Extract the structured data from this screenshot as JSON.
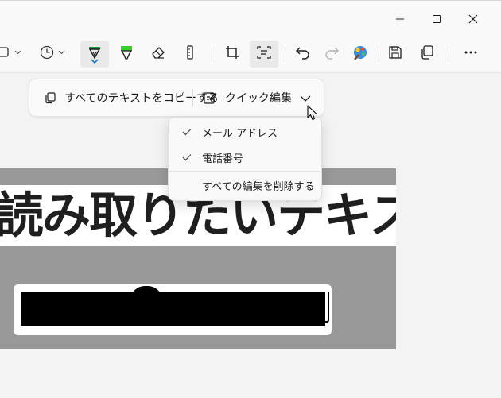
{
  "titlebar": {
    "minimize_icon": "minimize-icon",
    "maximize_icon": "maximize-icon",
    "close_icon": "close-icon"
  },
  "toolbar": {
    "items": [
      {
        "name": "shape-selection-tool",
        "icon": "rectangle-select-icon",
        "has_dropdown": true
      },
      {
        "name": "delay-timer",
        "icon": "clock-icon",
        "has_dropdown": true
      },
      {
        "name": "ballpoint-pen",
        "icon": "pen-icon",
        "active": true,
        "color": "#1a9c4a"
      },
      {
        "name": "highlighter",
        "icon": "highlighter-icon",
        "color": "#2fd12f"
      },
      {
        "name": "eraser",
        "icon": "eraser-icon"
      },
      {
        "name": "ruler",
        "icon": "ruler-icon"
      },
      {
        "name": "crop",
        "icon": "crop-icon"
      },
      {
        "name": "text-actions",
        "icon": "text-actions-icon",
        "active": true
      },
      {
        "name": "undo",
        "icon": "undo-icon"
      },
      {
        "name": "redo",
        "icon": "redo-icon",
        "disabled": true
      },
      {
        "name": "paint",
        "icon": "paint-app-icon"
      },
      {
        "name": "save",
        "icon": "save-icon"
      },
      {
        "name": "copy",
        "icon": "copy-icon"
      },
      {
        "name": "more",
        "icon": "more-icon"
      }
    ]
  },
  "text_actions": {
    "copy_all_label": "すべてのテキストをコピーする",
    "quick_redact_label": "クイック編集"
  },
  "menu": {
    "items": [
      {
        "label": "メール アドレス",
        "checked": true
      },
      {
        "label": "電話番号",
        "checked": true
      },
      {
        "label": "すべての編集を削除する",
        "checked": false
      }
    ]
  },
  "image": {
    "headline": "読み取りたいテキスト"
  },
  "colors": {
    "accent": "#0067c0",
    "pen": "#1a9c4a",
    "highlighter": "#2fd12f"
  }
}
